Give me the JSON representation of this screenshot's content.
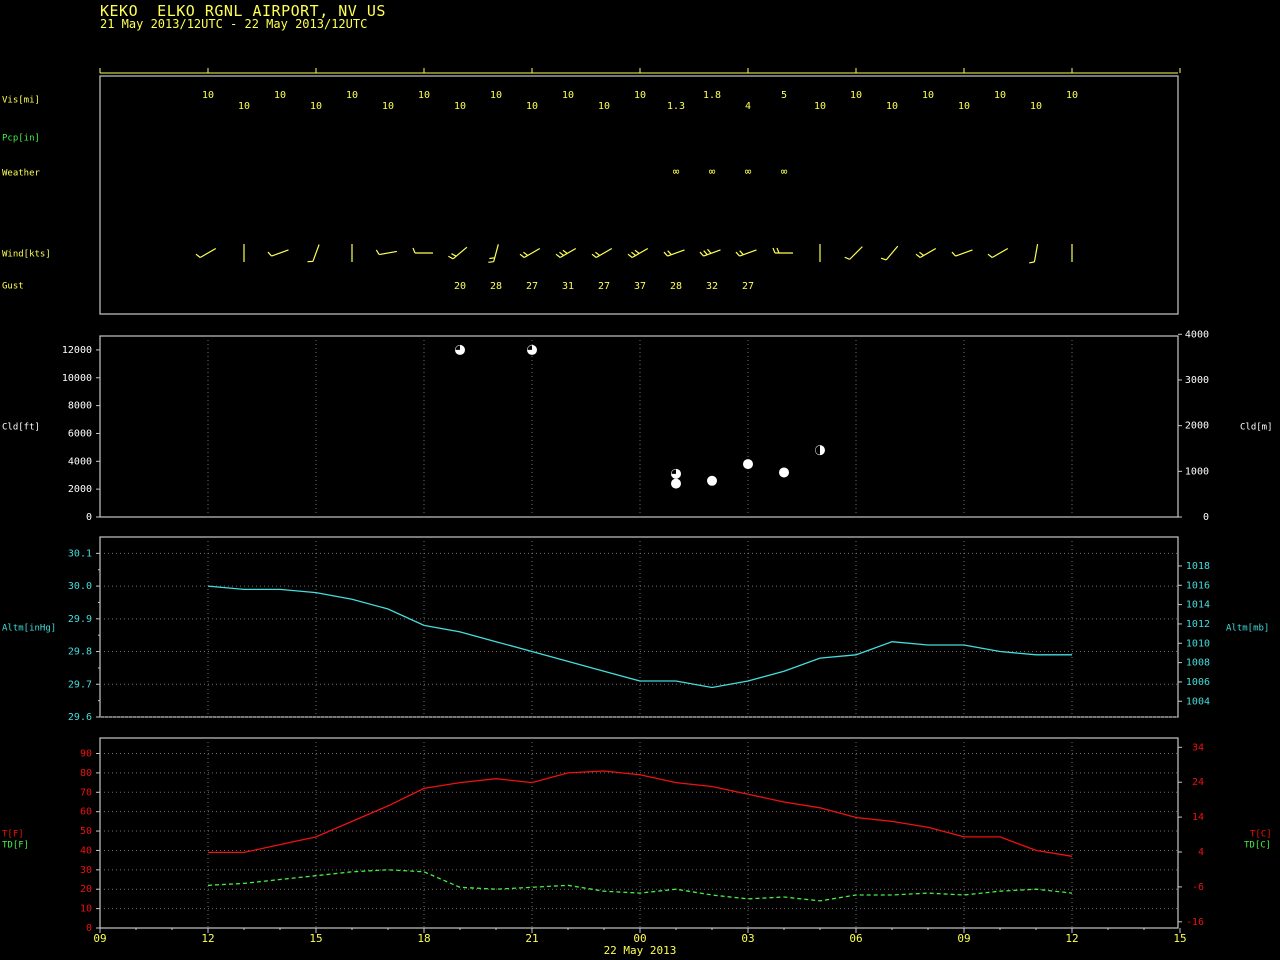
{
  "header": {
    "title": "KEKO  ELKO RGNL AIRPORT, NV US",
    "subtitle": "21 May 2013/12UTC - 22 May 2013/12UTC"
  },
  "colors": {
    "background": "#000000",
    "frame": "#c8c8c8",
    "grid": "#707070",
    "yellow": "#ffff55",
    "green": "#44ee44",
    "cyan": "#44dddd",
    "red": "#ee1111",
    "white": "#ffffff"
  },
  "time_axis": {
    "ticks": [
      {
        "h": 0,
        "label": "09"
      },
      {
        "h": 3,
        "label": "12"
      },
      {
        "h": 6,
        "label": "15"
      },
      {
        "h": 9,
        "label": "18"
      },
      {
        "h": 12,
        "label": "21"
      },
      {
        "h": 15,
        "label": "00"
      },
      {
        "h": 18,
        "label": "03"
      },
      {
        "h": 21,
        "label": "06"
      },
      {
        "h": 24,
        "label": "09"
      },
      {
        "h": 27,
        "label": "12"
      },
      {
        "h": 30,
        "label": "15"
      }
    ],
    "date_label": "22 May 2013"
  },
  "chart_data": [
    {
      "type": "table",
      "panel": "observations",
      "row_labels": {
        "visibility": "Vis[mi]",
        "precipitation": "Pcp[in]",
        "weather": "Weather",
        "wind": "Wind[kts]",
        "gust": "Gust"
      },
      "visibility": [
        {
          "h": 3,
          "v": "10"
        },
        {
          "h": 4,
          "v": "10"
        },
        {
          "h": 5,
          "v": "10"
        },
        {
          "h": 6,
          "v": "10"
        },
        {
          "h": 7,
          "v": "10"
        },
        {
          "h": 8,
          "v": "10"
        },
        {
          "h": 9,
          "v": "10"
        },
        {
          "h": 10,
          "v": "10"
        },
        {
          "h": 11,
          "v": "10"
        },
        {
          "h": 12,
          "v": "10"
        },
        {
          "h": 13,
          "v": "10"
        },
        {
          "h": 14,
          "v": "10"
        },
        {
          "h": 15,
          "v": "10"
        },
        {
          "h": 16,
          "v": "1.3"
        },
        {
          "h": 17,
          "v": "1.8"
        },
        {
          "h": 18,
          "v": "4"
        },
        {
          "h": 19,
          "v": "5"
        },
        {
          "h": 20,
          "v": "10"
        },
        {
          "h": 21,
          "v": "10"
        },
        {
          "h": 22,
          "v": "10"
        },
        {
          "h": 23,
          "v": "10"
        },
        {
          "h": 24,
          "v": "10"
        },
        {
          "h": 25,
          "v": "10"
        },
        {
          "h": 26,
          "v": "10"
        },
        {
          "h": 27,
          "v": "10"
        }
      ],
      "weather": [
        {
          "h": 16,
          "v": "∞"
        },
        {
          "h": 17,
          "v": "∞"
        },
        {
          "h": 18,
          "v": "∞"
        },
        {
          "h": 19,
          "v": "∞"
        }
      ],
      "wind": [
        {
          "h": 3,
          "dir": 240,
          "barbs": 1
        },
        {
          "h": 4,
          "dir": 180,
          "barbs": 0
        },
        {
          "h": 5,
          "dir": 250,
          "barbs": 1
        },
        {
          "h": 6,
          "dir": 200,
          "barbs": 1
        },
        {
          "h": 7,
          "dir": 180,
          "barbs": 0
        },
        {
          "h": 8,
          "dir": 260,
          "barbs": 1
        },
        {
          "h": 9,
          "dir": 270,
          "barbs": 1
        },
        {
          "h": 10,
          "dir": 230,
          "barbs": 2
        },
        {
          "h": 11,
          "dir": 195,
          "barbs": 2
        },
        {
          "h": 12,
          "dir": 240,
          "barbs": 2
        },
        {
          "h": 13,
          "dir": 240,
          "barbs": 3
        },
        {
          "h": 14,
          "dir": 240,
          "barbs": 2
        },
        {
          "h": 15,
          "dir": 240,
          "barbs": 3
        },
        {
          "h": 16,
          "dir": 250,
          "barbs": 2
        },
        {
          "h": 17,
          "dir": 250,
          "barbs": 3
        },
        {
          "h": 18,
          "dir": 250,
          "barbs": 2
        },
        {
          "h": 19,
          "dir": 270,
          "barbs": 2
        },
        {
          "h": 20,
          "dir": 180,
          "barbs": 0
        },
        {
          "h": 21,
          "dir": 225,
          "barbs": 1
        },
        {
          "h": 22,
          "dir": 220,
          "barbs": 1
        },
        {
          "h": 23,
          "dir": 240,
          "barbs": 2
        },
        {
          "h": 24,
          "dir": 250,
          "barbs": 1
        },
        {
          "h": 25,
          "dir": 240,
          "barbs": 1
        },
        {
          "h": 26,
          "dir": 190,
          "barbs": 1
        },
        {
          "h": 27,
          "dir": 180,
          "barbs": 0
        }
      ],
      "gust": [
        {
          "h": 10,
          "v": "20"
        },
        {
          "h": 11,
          "v": "28"
        },
        {
          "h": 12,
          "v": "27"
        },
        {
          "h": 13,
          "v": "31"
        },
        {
          "h": 14,
          "v": "27"
        },
        {
          "h": 15,
          "v": "37"
        },
        {
          "h": 16,
          "v": "28"
        },
        {
          "h": 17,
          "v": "32"
        },
        {
          "h": 18,
          "v": "27"
        }
      ]
    },
    {
      "type": "scatter",
      "panel": "cloud",
      "ylabel": "Cld[ft]",
      "y2label": "Cld[m]",
      "ylim": [
        0,
        13000
      ],
      "yticks": [
        0,
        2000,
        4000,
        6000,
        8000,
        10000,
        12000
      ],
      "y2ticks": [
        0,
        1000,
        2000,
        3000,
        4000
      ],
      "points": [
        {
          "h": 10,
          "ft": 12000,
          "cover": "broken"
        },
        {
          "h": 12,
          "ft": 12000,
          "cover": "broken"
        },
        {
          "h": 16,
          "ft": 3100,
          "cover": "broken"
        },
        {
          "h": 16,
          "ft": 2400,
          "cover": "overcast"
        },
        {
          "h": 17,
          "ft": 2600,
          "cover": "overcast"
        },
        {
          "h": 18,
          "ft": 3800,
          "cover": "overcast"
        },
        {
          "h": 19,
          "ft": 3200,
          "cover": "overcast"
        },
        {
          "h": 20,
          "ft": 4800,
          "cover": "scattered"
        }
      ]
    },
    {
      "type": "line",
      "panel": "altimeter",
      "ylabel": "Altm[inHg]",
      "y2label": "Altm[mb]",
      "ylim": [
        29.6,
        30.15
      ],
      "yticks": [
        29.6,
        29.7,
        29.8,
        29.9,
        30.0,
        30.1
      ],
      "ytick_labels": [
        "29.6",
        "29.7",
        "29.8",
        "29.9",
        "30.0",
        "30.1"
      ],
      "y2ticks": [
        1004,
        1006,
        1008,
        1010,
        1012,
        1014,
        1016,
        1018
      ],
      "series": [
        {
          "values": [
            {
              "h": 3,
              "v": 30.0
            },
            {
              "h": 4,
              "v": 29.99
            },
            {
              "h": 5,
              "v": 29.99
            },
            {
              "h": 6,
              "v": 29.98
            },
            {
              "h": 7,
              "v": 29.96
            },
            {
              "h": 8,
              "v": 29.93
            },
            {
              "h": 9,
              "v": 29.88
            },
            {
              "h": 10,
              "v": 29.86
            },
            {
              "h": 11,
              "v": 29.83
            },
            {
              "h": 12,
              "v": 29.8
            },
            {
              "h": 13,
              "v": 29.77
            },
            {
              "h": 14,
              "v": 29.74
            },
            {
              "h": 15,
              "v": 29.71
            },
            {
              "h": 16,
              "v": 29.71
            },
            {
              "h": 17,
              "v": 29.69
            },
            {
              "h": 18,
              "v": 29.71
            },
            {
              "h": 19,
              "v": 29.74
            },
            {
              "h": 20,
              "v": 29.78
            },
            {
              "h": 21,
              "v": 29.79
            },
            {
              "h": 22,
              "v": 29.83
            },
            {
              "h": 23,
              "v": 29.82
            },
            {
              "h": 24,
              "v": 29.82
            },
            {
              "h": 25,
              "v": 29.8
            },
            {
              "h": 26,
              "v": 29.79
            },
            {
              "h": 27,
              "v": 29.79
            }
          ]
        }
      ]
    },
    {
      "type": "line",
      "panel": "temperature",
      "ylabels": [
        "T[F]",
        "TD[F]"
      ],
      "y2labels": [
        "T[C]",
        "TD[C]"
      ],
      "ylim": [
        0,
        98
      ],
      "yticks": [
        0,
        10,
        20,
        30,
        40,
        50,
        60,
        70,
        80,
        90
      ],
      "y2ticks": [
        -16,
        -6,
        4,
        14,
        24,
        34
      ],
      "series": [
        {
          "name": "T[F]",
          "values": [
            {
              "h": 3,
              "v": 39
            },
            {
              "h": 4,
              "v": 39
            },
            {
              "h": 5,
              "v": 43
            },
            {
              "h": 6,
              "v": 47
            },
            {
              "h": 7,
              "v": 55
            },
            {
              "h": 8,
              "v": 63
            },
            {
              "h": 9,
              "v": 72
            },
            {
              "h": 10,
              "v": 75
            },
            {
              "h": 11,
              "v": 77
            },
            {
              "h": 12,
              "v": 75
            },
            {
              "h": 13,
              "v": 80
            },
            {
              "h": 14,
              "v": 81
            },
            {
              "h": 15,
              "v": 79
            },
            {
              "h": 16,
              "v": 75
            },
            {
              "h": 17,
              "v": 73
            },
            {
              "h": 18,
              "v": 69
            },
            {
              "h": 19,
              "v": 65
            },
            {
              "h": 20,
              "v": 62
            },
            {
              "h": 21,
              "v": 57
            },
            {
              "h": 22,
              "v": 55
            },
            {
              "h": 23,
              "v": 52
            },
            {
              "h": 24,
              "v": 47
            },
            {
              "h": 25,
              "v": 47
            },
            {
              "h": 26,
              "v": 40
            },
            {
              "h": 27,
              "v": 37
            }
          ]
        },
        {
          "name": "TD[F]",
          "values": [
            {
              "h": 3,
              "v": 22
            },
            {
              "h": 4,
              "v": 23
            },
            {
              "h": 5,
              "v": 25
            },
            {
              "h": 6,
              "v": 27
            },
            {
              "h": 7,
              "v": 29
            },
            {
              "h": 8,
              "v": 30
            },
            {
              "h": 9,
              "v": 29
            },
            {
              "h": 10,
              "v": 21
            },
            {
              "h": 11,
              "v": 20
            },
            {
              "h": 12,
              "v": 21
            },
            {
              "h": 13,
              "v": 22
            },
            {
              "h": 14,
              "v": 19
            },
            {
              "h": 15,
              "v": 18
            },
            {
              "h": 16,
              "v": 20
            },
            {
              "h": 17,
              "v": 17
            },
            {
              "h": 18,
              "v": 15
            },
            {
              "h": 19,
              "v": 16
            },
            {
              "h": 20,
              "v": 14
            },
            {
              "h": 21,
              "v": 17
            },
            {
              "h": 22,
              "v": 17
            },
            {
              "h": 23,
              "v": 18
            },
            {
              "h": 24,
              "v": 17
            },
            {
              "h": 25,
              "v": 19
            },
            {
              "h": 26,
              "v": 20
            },
            {
              "h": 27,
              "v": 18
            }
          ]
        }
      ]
    }
  ]
}
